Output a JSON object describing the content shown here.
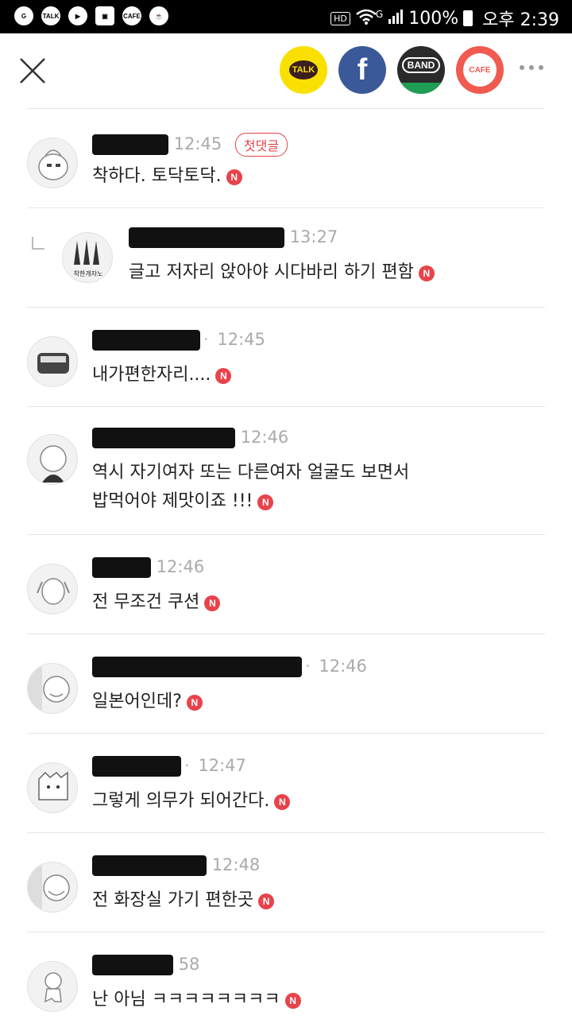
{
  "status": {
    "left_icons": [
      "G",
      "TALK",
      "▶",
      "▣",
      "CAFE",
      "☕"
    ],
    "hd": "HD",
    "network": "G",
    "battery": "100%",
    "time": "오후 2:39"
  },
  "topbar": {
    "share": [
      {
        "label": "TALK",
        "color": "#f9e000",
        "text_color": "#3b1e1e"
      },
      {
        "label": "f",
        "color": "#3b5998",
        "text_color": "#ffffff"
      },
      {
        "label": "BAND",
        "color": "#2a2a2a",
        "text_color": "#ffffff"
      },
      {
        "label": "CAFE",
        "color": "#f05a4f",
        "text_color": "#ffffff"
      }
    ]
  },
  "comments": [
    {
      "name": "",
      "time": "12:45",
      "badge": "첫댓글",
      "text": "착하다. 토닥토닥.",
      "n": "N"
    },
    {
      "name": "",
      "time": "13:27",
      "text": "글고 저자리 앉아야 시다바리 하기 편함",
      "n": "N",
      "reply": true
    },
    {
      "name": "",
      "time": "12:45",
      "text": "내가편한자리....",
      "n": "N"
    },
    {
      "name": "",
      "time": "12:46",
      "text1": "역시 자기여자 또는 다른여자 얼굴도 보면서",
      "text2": "밥먹어야 제맛이죠 !!!",
      "n": "N"
    },
    {
      "name": "",
      "time": "12:46",
      "text": "전 무조건 쿠션",
      "n": "N"
    },
    {
      "name": "",
      "time": "12:46",
      "text": "일본어인데?",
      "n": "N"
    },
    {
      "name": "",
      "time": "12:47",
      "text": "그렇게 의무가 되어간다.",
      "n": "N"
    },
    {
      "name": "",
      "time": "12:48",
      "text": "전 화장실 가기 편한곳",
      "n": "N"
    },
    {
      "name": "",
      "time": "58",
      "text": "난 아님 ㅋㅋㅋㅋㅋㅋㅋㅋ",
      "n": "N"
    }
  ]
}
